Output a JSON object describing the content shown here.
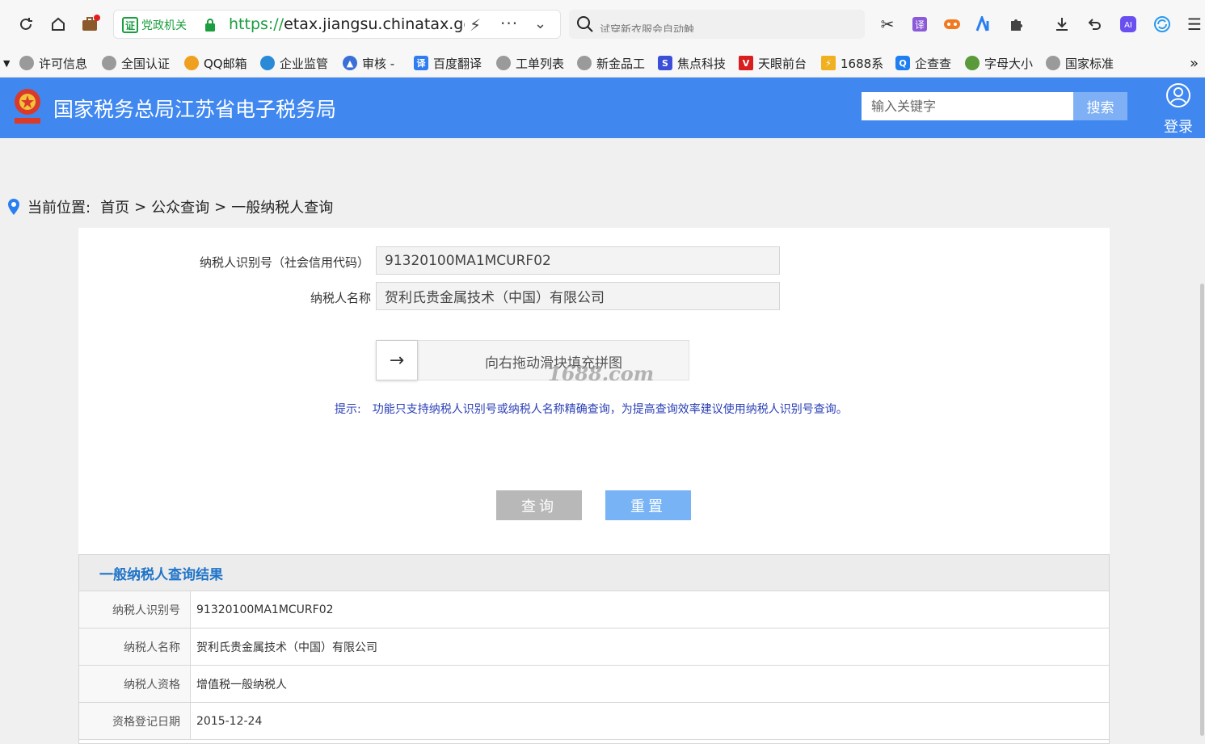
{
  "browser": {
    "badge_text": "党政机关",
    "url_protocol": "https://",
    "url_rest": "etax.jiangsu.chinatax.gov.cn",
    "search_placeholder": "试穿新衣服会自动触"
  },
  "bookmarks": [
    {
      "label": "许可信息",
      "color": "#9a9a9a"
    },
    {
      "label": "全国认证",
      "color": "#9a9a9a"
    },
    {
      "label": "QQ邮箱",
      "color": "#f0a020"
    },
    {
      "label": "企业监管",
      "color": "#2a8ad8"
    },
    {
      "label": "审核 -",
      "color": "#3a6fd8"
    },
    {
      "label": "百度翻译",
      "color": "#2f7df0"
    },
    {
      "label": "工单列表",
      "color": "#9a9a9a"
    },
    {
      "label": "新金品工",
      "color": "#9a9a9a"
    },
    {
      "label": "焦点科技",
      "color": "#3b4fd8"
    },
    {
      "label": "天眼前台",
      "color": "#d81e1e"
    },
    {
      "label": "1688系",
      "color": "#f0b020"
    },
    {
      "label": "企查查",
      "color": "#1f7ff0"
    },
    {
      "label": "字母大小",
      "color": "#5a9a3a"
    },
    {
      "label": "国家标准",
      "color": "#9a9a9a"
    }
  ],
  "header": {
    "title": "国家税务总局江苏省电子税务局",
    "search_placeholder": "输入关键字",
    "search_button": "搜索",
    "login": "登录"
  },
  "breadcrumb": {
    "prefix": "当前位置:",
    "items": [
      "首页",
      "公众查询",
      "一般纳税人查询"
    ],
    "separator": ">"
  },
  "form": {
    "tax_id_label": "纳税人识别号（社会信用代码）",
    "tax_id_value": "91320100MA1MCURF02",
    "name_label": "纳税人名称",
    "name_value": "贺利氏贵金属技术（中国）有限公司",
    "slider_text": "向右拖动滑块填充拼图",
    "watermark": "1688.com",
    "hint_key": "提示:",
    "hint_text": "功能只支持纳税人识别号或纳税人名称精确查询，为提高查询效率建议使用纳税人识别号查询。",
    "query_button": "查询",
    "reset_button": "重置"
  },
  "result": {
    "title": "一般纳税人查询结果",
    "rows": [
      {
        "key": "纳税人识别号",
        "value": "91320100MA1MCURF02"
      },
      {
        "key": "纳税人名称",
        "value": "贺利氏贵金属技术（中国）有限公司"
      },
      {
        "key": "纳税人资格",
        "value": "增值税一般纳税人"
      },
      {
        "key": "资格登记日期",
        "value": "2015-12-24"
      }
    ]
  },
  "colors": {
    "header_blue": "#4088f0",
    "result_title": "#1f74c8",
    "hint_blue": "#2a3fb5"
  }
}
